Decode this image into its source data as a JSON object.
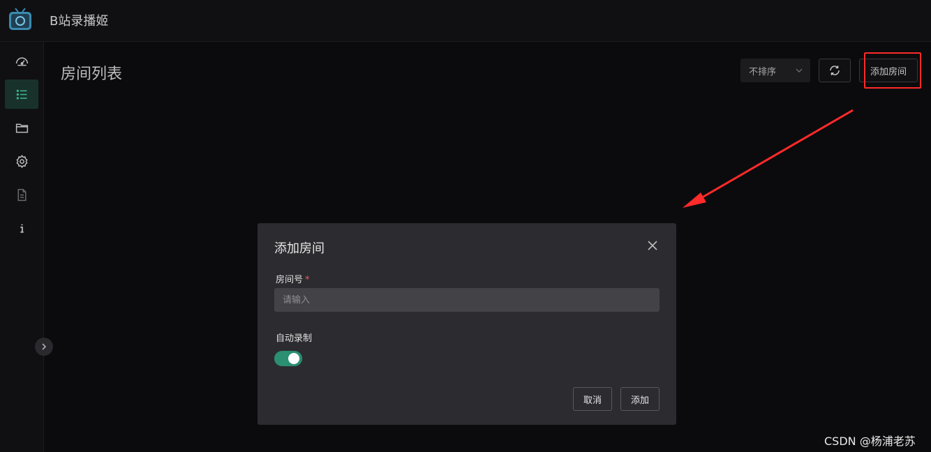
{
  "app": {
    "title": "B站录播姬"
  },
  "sidebar": {
    "items": [
      {
        "icon": "dashboard-icon",
        "active": false
      },
      {
        "icon": "list-icon",
        "active": true
      },
      {
        "icon": "folder-icon",
        "active": false
      },
      {
        "icon": "settings-icon",
        "active": false
      },
      {
        "icon": "document-icon",
        "active": false
      },
      {
        "icon": "info-icon",
        "active": false
      }
    ],
    "expand_icon": "chevron-right-icon"
  },
  "main": {
    "page_title": "房间列表",
    "sort": {
      "selected": "不排序"
    },
    "refresh_icon": "refresh-icon",
    "add_room_label": "添加房间"
  },
  "modal": {
    "title": "添加房间",
    "room_id_label": "房间号",
    "required_mark": "*",
    "room_id_placeholder": "请输入",
    "room_id_value": "",
    "auto_record_label": "自动录制",
    "auto_record_enabled": true,
    "cancel_label": "取消",
    "confirm_label": "添加"
  },
  "watermark": "CSDN @杨浦老苏",
  "colors": {
    "accent": "#2b8f72",
    "annotation": "#ff2a2a",
    "background": "#0b0b0d",
    "modal": "#2c2c30"
  }
}
